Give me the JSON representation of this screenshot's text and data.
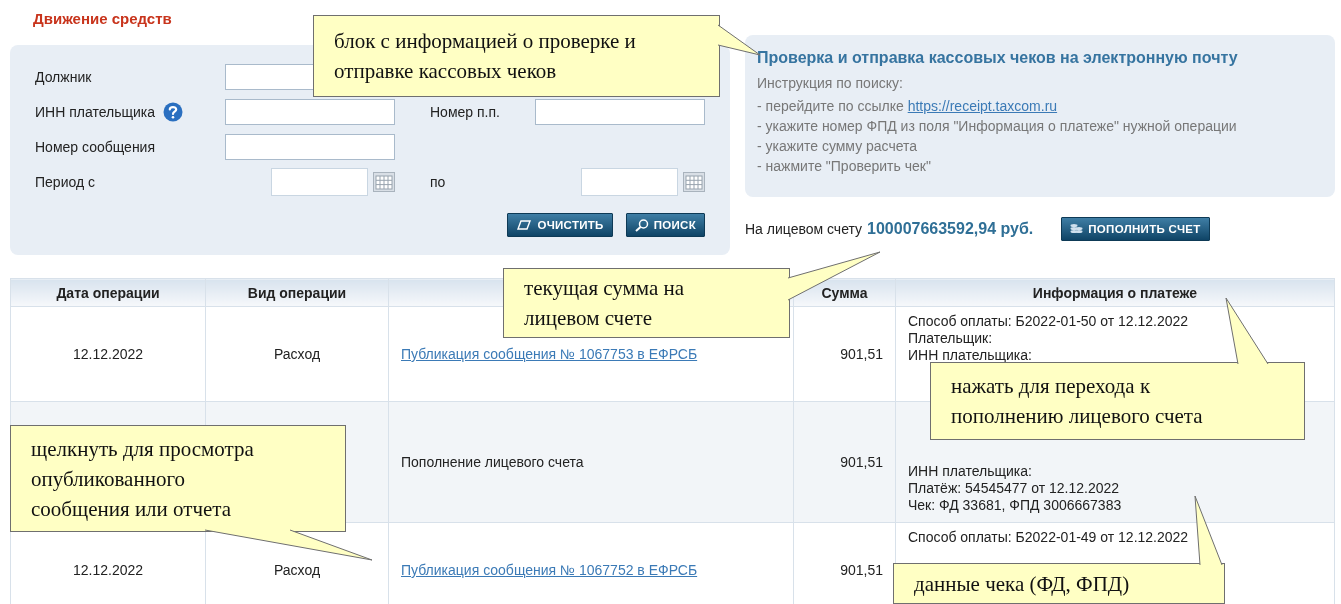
{
  "page_title": "Движение средств",
  "filters": {
    "rows": [
      [
        {
          "label": "Должник",
          "kind": "text",
          "help": false
        }
      ],
      [
        {
          "label": "ИНН плательщика",
          "kind": "text",
          "help": true
        },
        {
          "label": "Номер п.п.",
          "kind": "text",
          "help": false
        }
      ],
      [
        {
          "label": "Номер сообщения",
          "kind": "text",
          "help": false
        }
      ],
      [
        {
          "label": "Период с",
          "kind": "date",
          "help": false
        },
        {
          "label": "по",
          "kind": "date",
          "help": false
        }
      ]
    ],
    "buttons": [
      {
        "label": "ОЧИСТИТЬ",
        "kind": "clear"
      },
      {
        "label": "ПОИСК",
        "kind": "search"
      }
    ]
  },
  "receipt_info": {
    "title": "Проверка и отправка кассовых чеков на электронную почту",
    "intro": "Инструкция по поиску:",
    "steps": [
      {
        "text": "- перейдите по ссылке",
        "link": "https://receipt.taxcom.ru"
      },
      {
        "text": "- укажите номер ФПД из поля \"Информация о платеже\" нужной операции"
      },
      {
        "text": "- укажите сумму расчета"
      },
      {
        "text": "- нажмите \"Проверить чек\""
      }
    ]
  },
  "balance": {
    "label": "На лицевом счету",
    "amount": "100007663592,94 руб.",
    "button": "ПОПОЛНИТЬ СЧЕТ"
  },
  "table": {
    "columns": [
      "Дата операции",
      "Вид операции",
      null,
      "Сумма",
      "Информация о платеже"
    ],
    "rows": [
      {
        "date": "12.12.2022",
        "type": "Расход",
        "description": {
          "kind": "link",
          "text": "Публикация сообщения № 1067753 в ЕФРСБ"
        },
        "amount": "901,51",
        "info": [
          "Способ оплаты: Б2022-01-50 от 12.12.2022",
          "Плательщик:",
          "ИНН плательщика:"
        ]
      },
      {
        "description": {
          "kind": "text",
          "text": "Пополнение лицевого счета"
        },
        "amount": "901,51",
        "info": [
          "ИНН плательщика:",
          "Платёж: 54545477 от 12.12.2022",
          "Чек: ФД 33681, ФПД 3006667383"
        ]
      },
      {
        "date": "12.12.2022",
        "type": "Расход",
        "description": {
          "kind": "link",
          "text": "Публикация сообщения № 1067752 в ЕФРСБ"
        },
        "amount": "901,51",
        "info": [
          "Способ оплаты: Б2022-01-49 от 12.12.2022"
        ]
      }
    ]
  },
  "callouts": [
    {
      "text": "блок с информацией о проверке и отправке кассовых чеков"
    },
    {
      "text": "текущая сумма на лицевом счете"
    },
    {
      "text": "нажать для перехода к пополнению лицевого счета"
    },
    {
      "text": "щелкнуть для просмотра опубликованного сообщения или отчета"
    },
    {
      "text": "данные чека (ФД, ФПД)"
    }
  ]
}
